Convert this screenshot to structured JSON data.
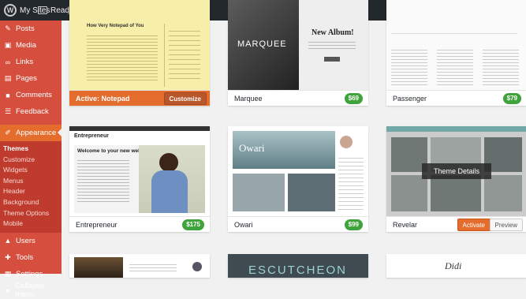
{
  "topbar": {
    "my_sites": "My Sites",
    "reader": "Reader"
  },
  "sidebar": {
    "top_items": [
      {
        "label": "Posts",
        "icon": "✎"
      },
      {
        "label": "Media",
        "icon": "▣"
      },
      {
        "label": "Links",
        "icon": "∞"
      },
      {
        "label": "Pages",
        "icon": "▤"
      },
      {
        "label": "Comments",
        "icon": "■"
      },
      {
        "label": "Feedback",
        "icon": "☰"
      }
    ],
    "appearance": "Appearance",
    "sub_items": [
      "Themes",
      "Customize",
      "Widgets",
      "Menus",
      "Header",
      "Background",
      "Theme Options",
      "Mobile"
    ],
    "bottom_items": [
      {
        "label": "Users",
        "icon": "▲"
      },
      {
        "label": "Tools",
        "icon": "✚"
      },
      {
        "label": "Settings",
        "icon": "▦"
      },
      {
        "label": "Collapse menu",
        "icon": "●"
      }
    ]
  },
  "themes": {
    "notepad": {
      "status": "Active: Notepad",
      "customize": "Customize",
      "page_title": "How Very Notepad of You"
    },
    "marquee": {
      "name": "Marquee",
      "price": "$69",
      "logo": "MARQUEE",
      "album": "New Album!"
    },
    "passenger": {
      "name": "Passenger",
      "price": "$79"
    },
    "entrepreneur": {
      "name": "Entrepreneur",
      "price": "$175",
      "logo": "Entrepreneur",
      "heading": "Welcome to your new website."
    },
    "owari": {
      "name": "Owari",
      "price": "$99",
      "logo": "Owari"
    },
    "revelar": {
      "name": "Revelar",
      "details": "Theme Details",
      "activate": "Activate",
      "preview": "Preview"
    },
    "row3": {
      "escutcheon": "ESCUTCHEON",
      "didi": "Didi"
    }
  }
}
